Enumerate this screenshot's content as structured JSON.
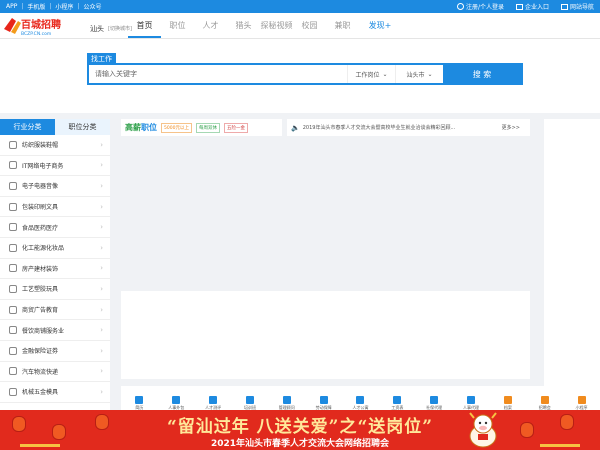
{
  "topbar": {
    "left_links": [
      "APP",
      "手机版",
      "小程序",
      "公众号"
    ],
    "right_links": [
      {
        "icon": "user-icon",
        "label": "注册/个人登录"
      },
      {
        "icon": "briefcase-icon",
        "label": "企业入口"
      },
      {
        "icon": "grid-icon",
        "label": "网站导航"
      }
    ]
  },
  "header": {
    "logo_text": "百城招聘",
    "logo_sub": "BCZP.CN.com",
    "city": "汕头",
    "city_switch": "[切换城市]",
    "nav": [
      "首页",
      "职位",
      "人才",
      "猎头",
      "探秘视频",
      "校园",
      "兼职",
      "发现+"
    ],
    "active_nav": "首页"
  },
  "search": {
    "tab_label": "找工作",
    "placeholder": "请输入关键字",
    "position_select": "工作岗位",
    "city_select": "汕头市",
    "button": "搜 索"
  },
  "category_tabs": [
    "行业分类",
    "职位分类"
  ],
  "categories": [
    {
      "label": "纺织服装鞋帽",
      "icon": "shirt-icon"
    },
    {
      "label": "IT网络电子商务",
      "icon": "globe-icon"
    },
    {
      "label": "电子电器音像",
      "icon": "chip-icon"
    },
    {
      "label": "包装印刷文具",
      "icon": "print-icon"
    },
    {
      "label": "食品医药医疗",
      "icon": "food-icon"
    },
    {
      "label": "化工能源化妆品",
      "icon": "flask-icon"
    },
    {
      "label": "房产建材装饰",
      "icon": "building-icon"
    },
    {
      "label": "工艺塑胶玩具",
      "icon": "toy-icon"
    },
    {
      "label": "商贸广告教育",
      "icon": "edu-icon"
    },
    {
      "label": "餐饮商铺服务业",
      "icon": "store-icon"
    },
    {
      "label": "金融保险证券",
      "icon": "finance-icon"
    },
    {
      "label": "汽车物流快递",
      "icon": "car-icon"
    },
    {
      "label": "机械五金模具",
      "icon": "gear-icon"
    }
  ],
  "gaoxin": {
    "logo_1": "高薪",
    "logo_2": "职位",
    "tags": [
      "5000元以上",
      "每周双休",
      "五险一金"
    ]
  },
  "notice": {
    "text": "2019年汕头市春季人才交流大会暨高校毕业生就业洽谈会精彩回顾...",
    "more": "更多>>"
  },
  "services": [
    "简历",
    "人事外包",
    "人才测评",
    "培训班",
    "管理顾问",
    "劳动保障",
    "人才公寓",
    "工资表",
    "社保代理",
    "人事代理",
    "档案",
    "招聘会",
    "小程序"
  ],
  "bottom_banner": {
    "title": "“留汕过年 八送关爱”之“送岗位”",
    "subtitle": "2021年汕头市春季人才交流大会网络招聘会"
  },
  "colors": {
    "primary": "#1d8ae0",
    "banner_red": "#e12a1d",
    "gold": "#ffe89a"
  }
}
